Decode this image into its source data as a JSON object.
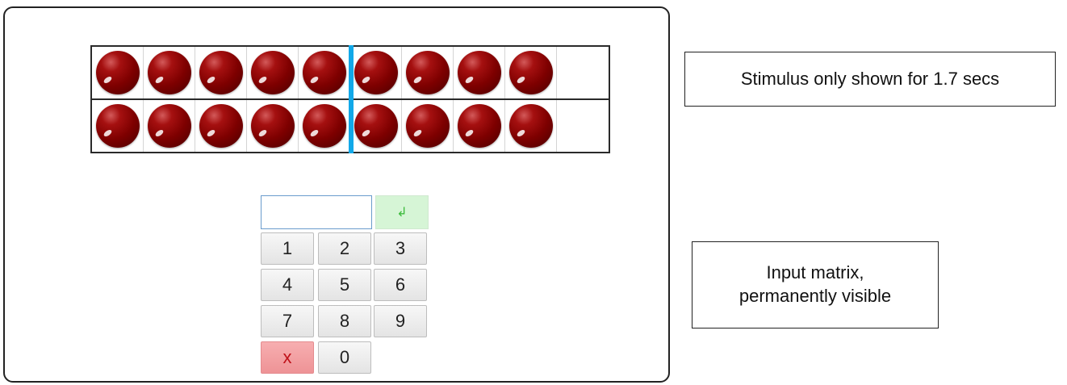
{
  "ten_frame": {
    "top_row_filled": 9,
    "bottom_row_filled": 9,
    "cells_per_row": 10,
    "dot_color": "#8b0000",
    "divider_color": "#12a8e8"
  },
  "keypad": {
    "input_value": "",
    "enter_label": "↲",
    "keys": [
      "1",
      "2",
      "3",
      "4",
      "5",
      "6",
      "7",
      "8",
      "9"
    ],
    "delete_label": "x",
    "zero_label": "0",
    "enter_color": "#d6f5d6",
    "delete_color": "#f2a0a2"
  },
  "annotations": {
    "stimulus_note": "Stimulus only shown for 1.7 secs",
    "input_note_lines": [
      "Input matrix,",
      "permanently visible"
    ]
  }
}
